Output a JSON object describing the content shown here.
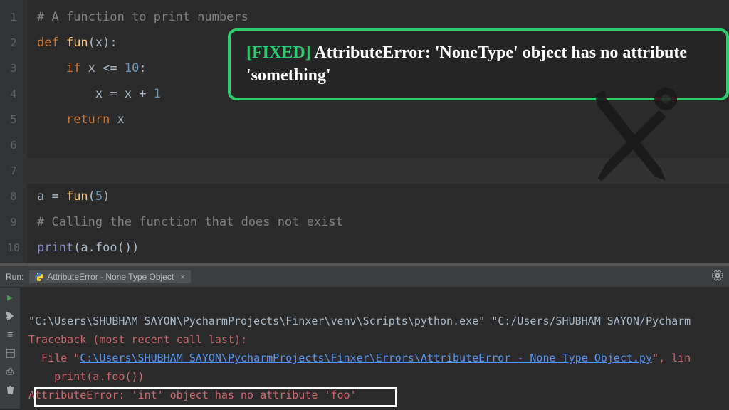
{
  "code": {
    "lines": [
      {
        "n": "1",
        "tokens": [
          [
            "c-comment",
            "# A function to print numbers"
          ]
        ]
      },
      {
        "n": "2",
        "fold": true,
        "tokens": [
          [
            "c-keyword",
            "def "
          ],
          [
            "c-func",
            "fun"
          ],
          [
            "c-punct",
            "(x):"
          ]
        ]
      },
      {
        "n": "3",
        "indent": 1,
        "tokens": [
          [
            "c-keyword",
            "if "
          ],
          [
            "c-ident",
            "x <= "
          ],
          [
            "c-num",
            "10"
          ],
          [
            "c-punct",
            ":"
          ]
        ]
      },
      {
        "n": "4",
        "indent": 2,
        "tokens": [
          [
            "c-ident",
            "x = x + "
          ],
          [
            "c-num",
            "1"
          ]
        ]
      },
      {
        "n": "5",
        "indent": 1,
        "foldEnd": true,
        "tokens": [
          [
            "c-keyword",
            "return "
          ],
          [
            "c-ident",
            "x"
          ]
        ]
      },
      {
        "n": "6",
        "tokens": []
      },
      {
        "n": "7",
        "current": true,
        "tokens": []
      },
      {
        "n": "8",
        "tokens": [
          [
            "c-ident",
            "a = "
          ],
          [
            "c-func",
            "fun"
          ],
          [
            "c-punct",
            "("
          ],
          [
            "c-num",
            "5"
          ],
          [
            "c-punct",
            ")"
          ]
        ]
      },
      {
        "n": "9",
        "tokens": [
          [
            "c-comment",
            "# Calling the function that does not exist"
          ]
        ]
      },
      {
        "n": "10",
        "tokens": [
          [
            "c-builtin",
            "print"
          ],
          [
            "c-punct",
            "(a.foo())"
          ]
        ]
      }
    ]
  },
  "callout": {
    "fixed": "[FIXED]",
    "text": " AttributeError: 'NoneType' object has no attribute 'something'"
  },
  "run": {
    "label": "Run:",
    "tab": "AttributeError - None Type Object",
    "close": "×"
  },
  "console": {
    "cmd": "\"C:\\Users\\SHUBHAM SAYON\\PycharmProjects\\Finxer\\venv\\Scripts\\python.exe\" \"C:/Users/SHUBHAM SAYON/Pycharm",
    "traceback": "Traceback (most recent call last):",
    "file_pre": "  File \"",
    "file_link": "C:\\Users\\SHUBHAM SAYON\\PycharmProjects\\Finxer\\Errors\\AttributeError - None Type Object.py",
    "file_post": "\", lin",
    "call": "    print(a.foo())",
    "error": "AttributeError: 'int' object has no attribute 'foo'"
  }
}
